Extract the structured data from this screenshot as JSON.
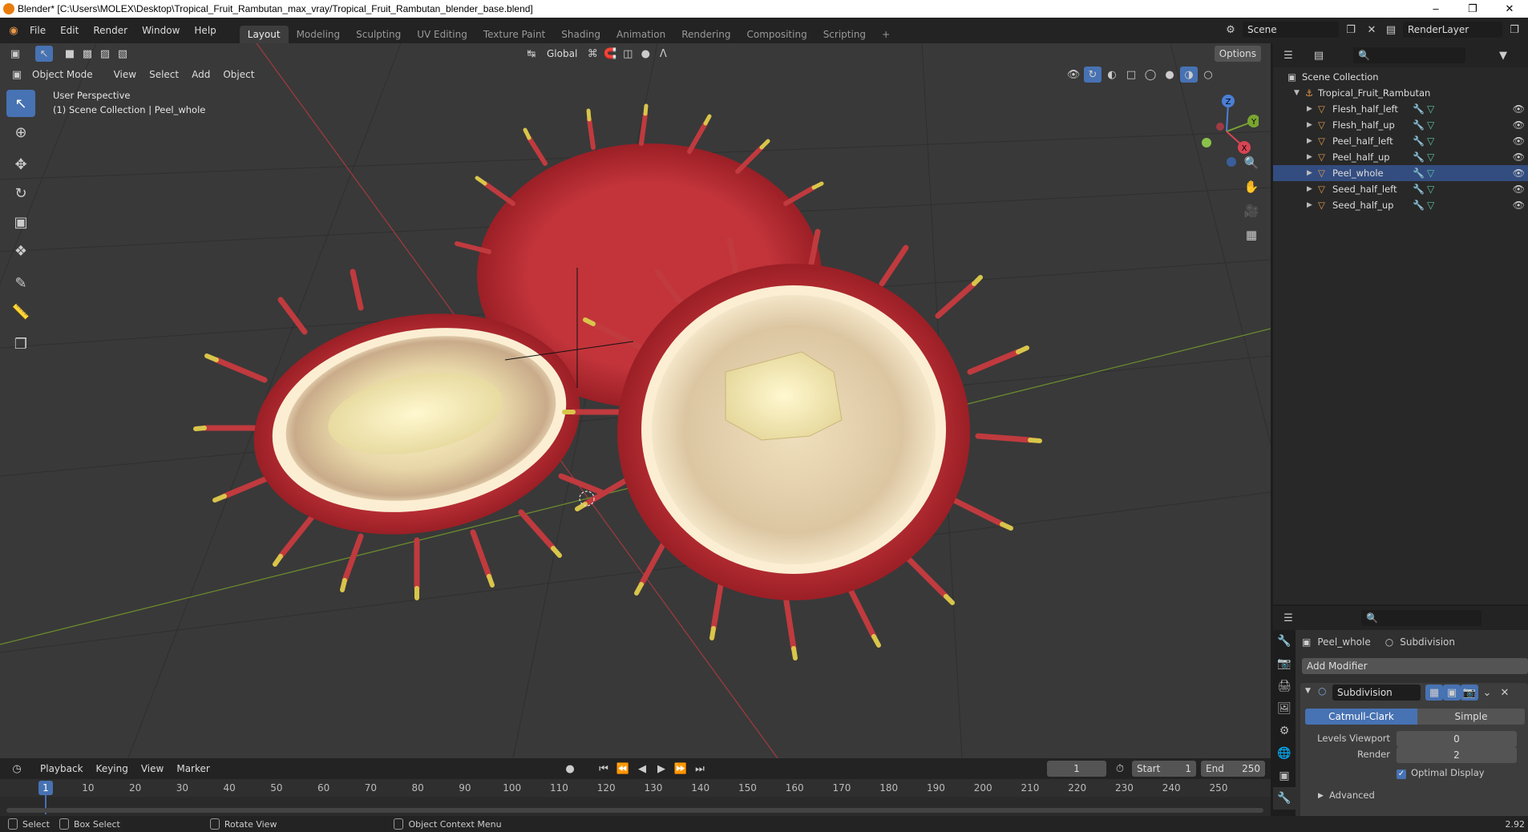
{
  "title_bar": {
    "text": "Blender* [C:\\Users\\MOLEX\\Desktop\\Tropical_Fruit_Rambutan_max_vray/Tropical_Fruit_Rambutan_blender_base.blend]"
  },
  "menu": [
    "File",
    "Edit",
    "Render",
    "Window",
    "Help"
  ],
  "workspaces": [
    "Layout",
    "Modeling",
    "Sculpting",
    "UV Editing",
    "Texture Paint",
    "Shading",
    "Animation",
    "Rendering",
    "Compositing",
    "Scripting"
  ],
  "active_workspace": "Layout",
  "scene": {
    "scene_name": "Scene",
    "view_layer": "RenderLayer"
  },
  "viewport": {
    "mode": "Object Mode",
    "menus": [
      "View",
      "Select",
      "Add",
      "Object"
    ],
    "orientation": "Global",
    "options_label": "Options",
    "info_line1": "User Perspective",
    "info_line2": "(1) Scene Collection | Peel_whole",
    "gizmo": {
      "z": "Z",
      "y": "Y",
      "x": "X"
    }
  },
  "outliner": {
    "root": "Scene Collection",
    "collection": "Tropical_Fruit_Rambutan",
    "objects": [
      "Flesh_half_left",
      "Flesh_half_up",
      "Peel_half_left",
      "Peel_half_up",
      "Peel_whole",
      "Seed_half_left",
      "Seed_half_up"
    ],
    "selected": "Peel_whole"
  },
  "properties": {
    "object": "Peel_whole",
    "modifier_breadcrumb": "Subdivision",
    "add_modifier": "Add Modifier",
    "modifier_name": "Subdivision",
    "tab_catmull": "Catmull-Clark",
    "tab_simple": "Simple",
    "levels_viewport_label": "Levels Viewport",
    "levels_viewport_value": "0",
    "render_label": "Render",
    "render_value": "2",
    "optimal_display": "Optimal Display",
    "advanced": "Advanced",
    "version": "2.92"
  },
  "timeline": {
    "menus": [
      "Playback",
      "Keying",
      "View",
      "Marker"
    ],
    "current_frame": "1",
    "start_label": "Start",
    "start_value": "1",
    "end_label": "End",
    "end_value": "250",
    "ticks": [
      "1",
      "10",
      "20",
      "30",
      "40",
      "50",
      "60",
      "70",
      "80",
      "90",
      "100",
      "110",
      "120",
      "130",
      "140",
      "150",
      "160",
      "170",
      "180",
      "190",
      "200",
      "210",
      "220",
      "230",
      "240",
      "250"
    ]
  },
  "statusbar": {
    "select": "Select",
    "box_select": "Box Select",
    "rotate_view": "Rotate View",
    "context_menu": "Object Context Menu"
  },
  "colors": {
    "accent": "#4772b3",
    "selected_row": "#334d80",
    "object_orange": "#e8984a"
  }
}
